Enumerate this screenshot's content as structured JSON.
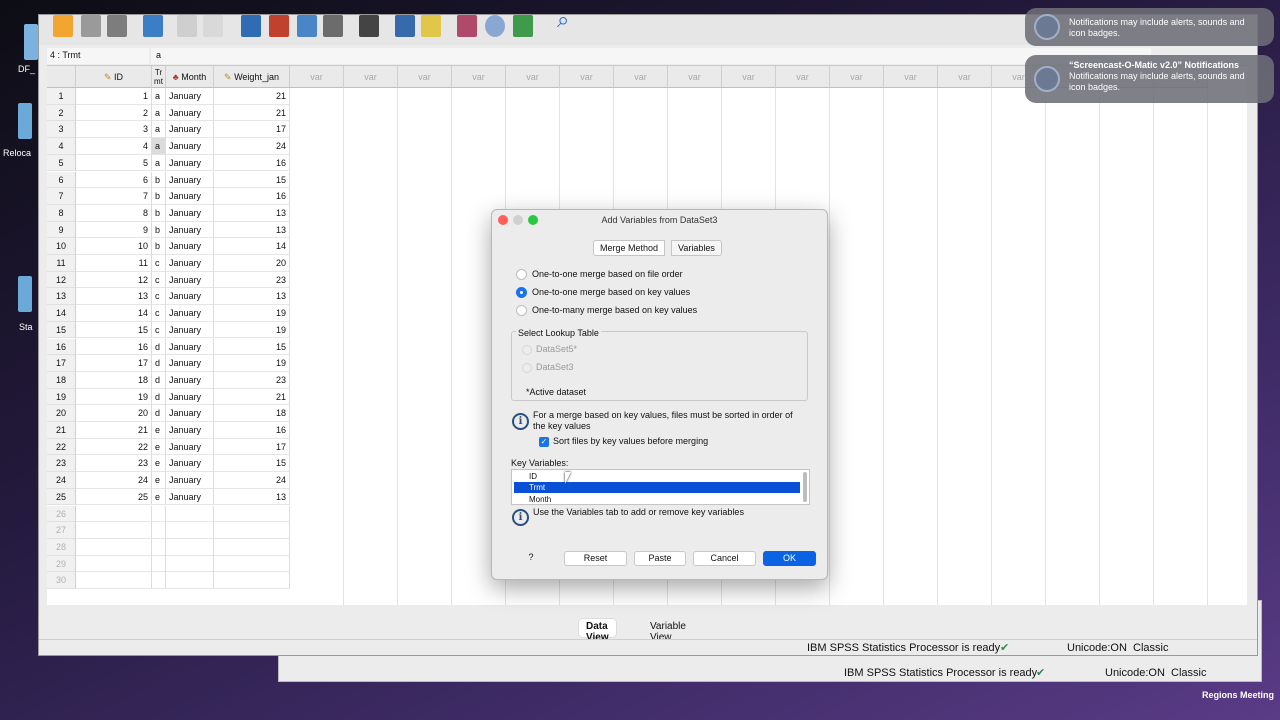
{
  "desktop": {
    "icons": [
      {
        "label": "DF_",
        "icon": "folder-icon"
      },
      {
        "label": "Reloca",
        "icon": "folder-icon"
      },
      {
        "label": "Sta",
        "icon": "folder-icon"
      }
    ],
    "bottom_label": "Regions Meeting"
  },
  "background_window": {
    "status": "IBM SPSS Statistics Processor is ready",
    "unicode": "Unicode:ON",
    "mode": "Classic"
  },
  "notifications": [
    {
      "title": "",
      "body": "Notifications may include alerts, sounds and icon badges."
    },
    {
      "title": "“Screencast-O-Matic v2.0” Notifications",
      "body": "Notifications may include alerts, sounds and icon badges."
    }
  ],
  "editor": {
    "cell_ref": "4 : Trmt",
    "cell_value": "a",
    "columns": [
      "ID",
      "Tr mt",
      "Month",
      "Weight_jan"
    ],
    "var_label": "var",
    "rows": [
      [
        "1",
        "a",
        "January",
        "21"
      ],
      [
        "2",
        "a",
        "January",
        "21"
      ],
      [
        "3",
        "a",
        "January",
        "17"
      ],
      [
        "4",
        "a",
        "January",
        "24"
      ],
      [
        "5",
        "a",
        "January",
        "16"
      ],
      [
        "6",
        "b",
        "January",
        "15"
      ],
      [
        "7",
        "b",
        "January",
        "16"
      ],
      [
        "8",
        "b",
        "January",
        "13"
      ],
      [
        "9",
        "b",
        "January",
        "13"
      ],
      [
        "10",
        "b",
        "January",
        "14"
      ],
      [
        "11",
        "c",
        "January",
        "20"
      ],
      [
        "12",
        "c",
        "January",
        "23"
      ],
      [
        "13",
        "c",
        "January",
        "13"
      ],
      [
        "14",
        "c",
        "January",
        "19"
      ],
      [
        "15",
        "c",
        "January",
        "19"
      ],
      [
        "16",
        "d",
        "January",
        "15"
      ],
      [
        "17",
        "d",
        "January",
        "19"
      ],
      [
        "18",
        "d",
        "January",
        "23"
      ],
      [
        "19",
        "d",
        "January",
        "21"
      ],
      [
        "20",
        "d",
        "January",
        "18"
      ],
      [
        "21",
        "e",
        "January",
        "16"
      ],
      [
        "22",
        "e",
        "January",
        "17"
      ],
      [
        "23",
        "e",
        "January",
        "15"
      ],
      [
        "24",
        "e",
        "January",
        "24"
      ],
      [
        "25",
        "e",
        "January",
        "13"
      ]
    ],
    "empty_rows": [
      "26",
      "27",
      "28",
      "29",
      "30"
    ],
    "tabs": [
      "Data View",
      "Variable View"
    ],
    "active_tab": "Data View",
    "status": "IBM SPSS Statistics Processor is ready",
    "unicode": "Unicode:ON",
    "mode": "Classic"
  },
  "dialog": {
    "title": "Add Variables from DataSet3",
    "tabs": [
      "Merge Method",
      "Variables"
    ],
    "active_tab": "Merge Method",
    "options": [
      "One-to-one merge based on file order",
      "One-to-one merge based on key values",
      "One-to-many merge based on key values"
    ],
    "selected_option": 1,
    "lookup_title": "Select Lookup Table",
    "lookup_items": [
      "DataSet5*",
      "DataSet3"
    ],
    "lookup_note": "*Active dataset",
    "sort_info": "For a merge based on key values, files must be sorted in order of the key values",
    "sort_checkbox": "Sort files by key values before merging",
    "sort_checked": true,
    "key_label": "Key Variables:",
    "key_items": [
      "ID",
      "Trmt",
      "Month"
    ],
    "selected_key": "Trmt",
    "key_note": "Use the Variables tab to add or remove key variables",
    "buttons": {
      "help": "?",
      "reset": "Reset",
      "paste": "Paste",
      "cancel": "Cancel",
      "ok": "OK"
    }
  },
  "colors": {
    "accent": "#0b63e4",
    "selection": "#0a50d6"
  }
}
